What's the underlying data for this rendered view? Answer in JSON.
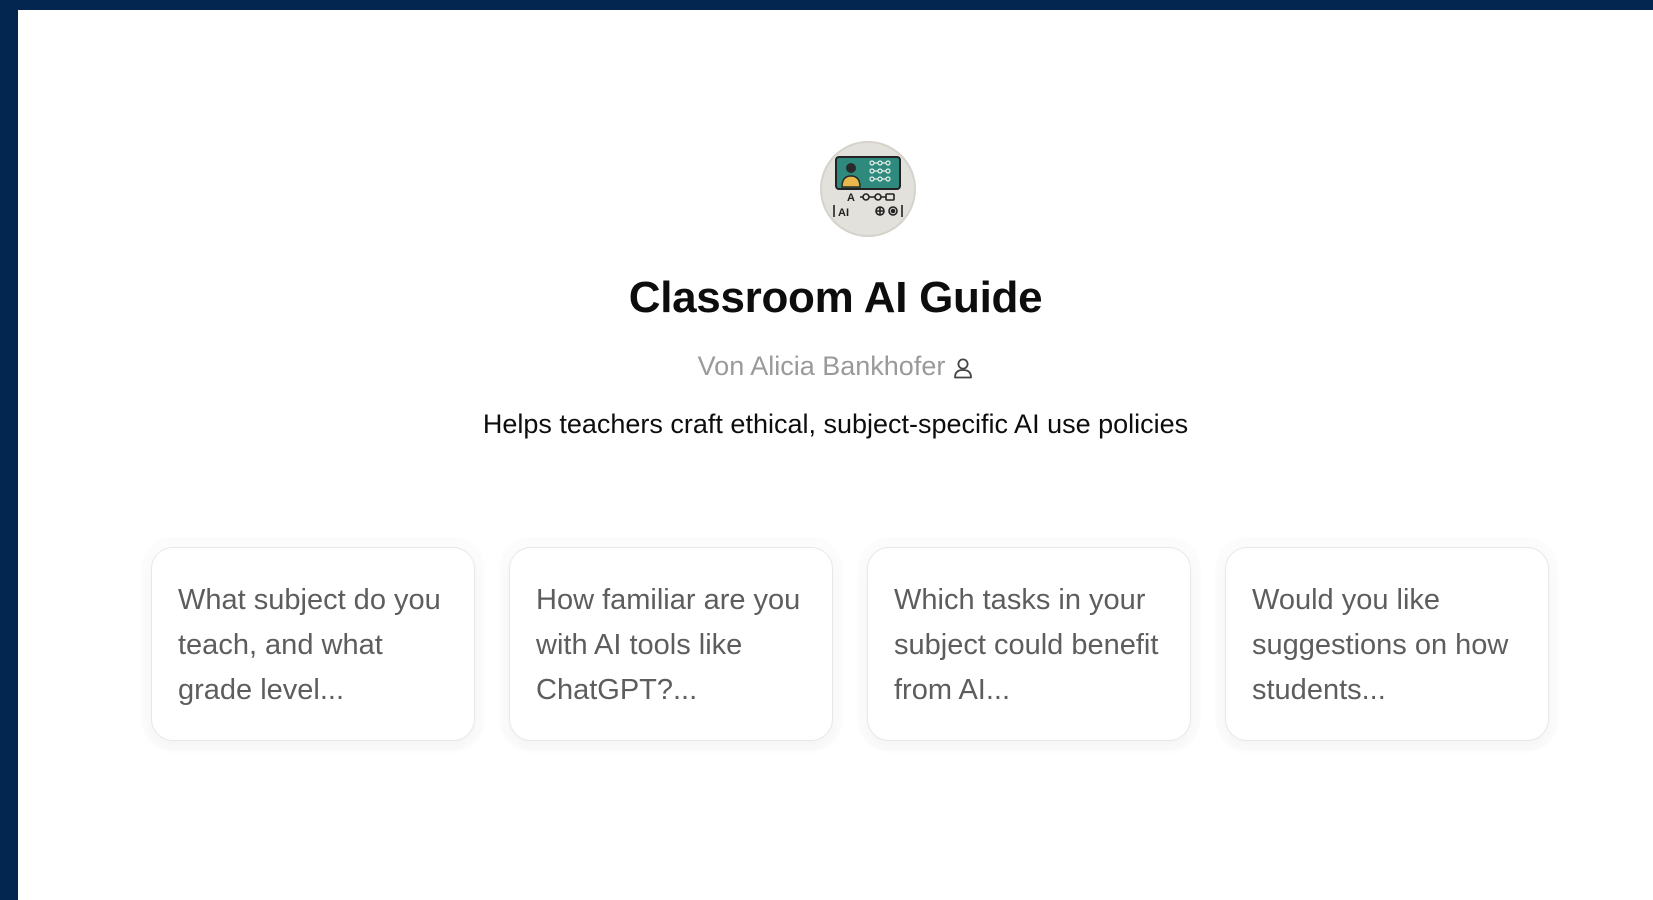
{
  "gpt": {
    "title": "Classroom AI Guide",
    "author": "Von Alicia Bankhofer",
    "description": "Helps teachers craft ethical, subject-specific AI use policies",
    "avatar": {
      "icon": "classroom-ai-logo-icon",
      "glyphs": [
        "A",
        "AI"
      ]
    }
  },
  "starters": [
    {
      "text": "What subject do you teach, and what grade level..."
    },
    {
      "text": "How familiar are you with AI tools like ChatGPT?..."
    },
    {
      "text": "Which tasks in your subject could benefit from AI..."
    },
    {
      "text": "Would you like suggestions on how students..."
    }
  ],
  "colors": {
    "frame": "#032650",
    "background": "#ffffff",
    "title": "#0d0d0d",
    "author": "#9a9a9a",
    "card_text": "#5d5d5d",
    "card_border": "#e7e7e7",
    "logo_screen": "#2f8a7e"
  }
}
